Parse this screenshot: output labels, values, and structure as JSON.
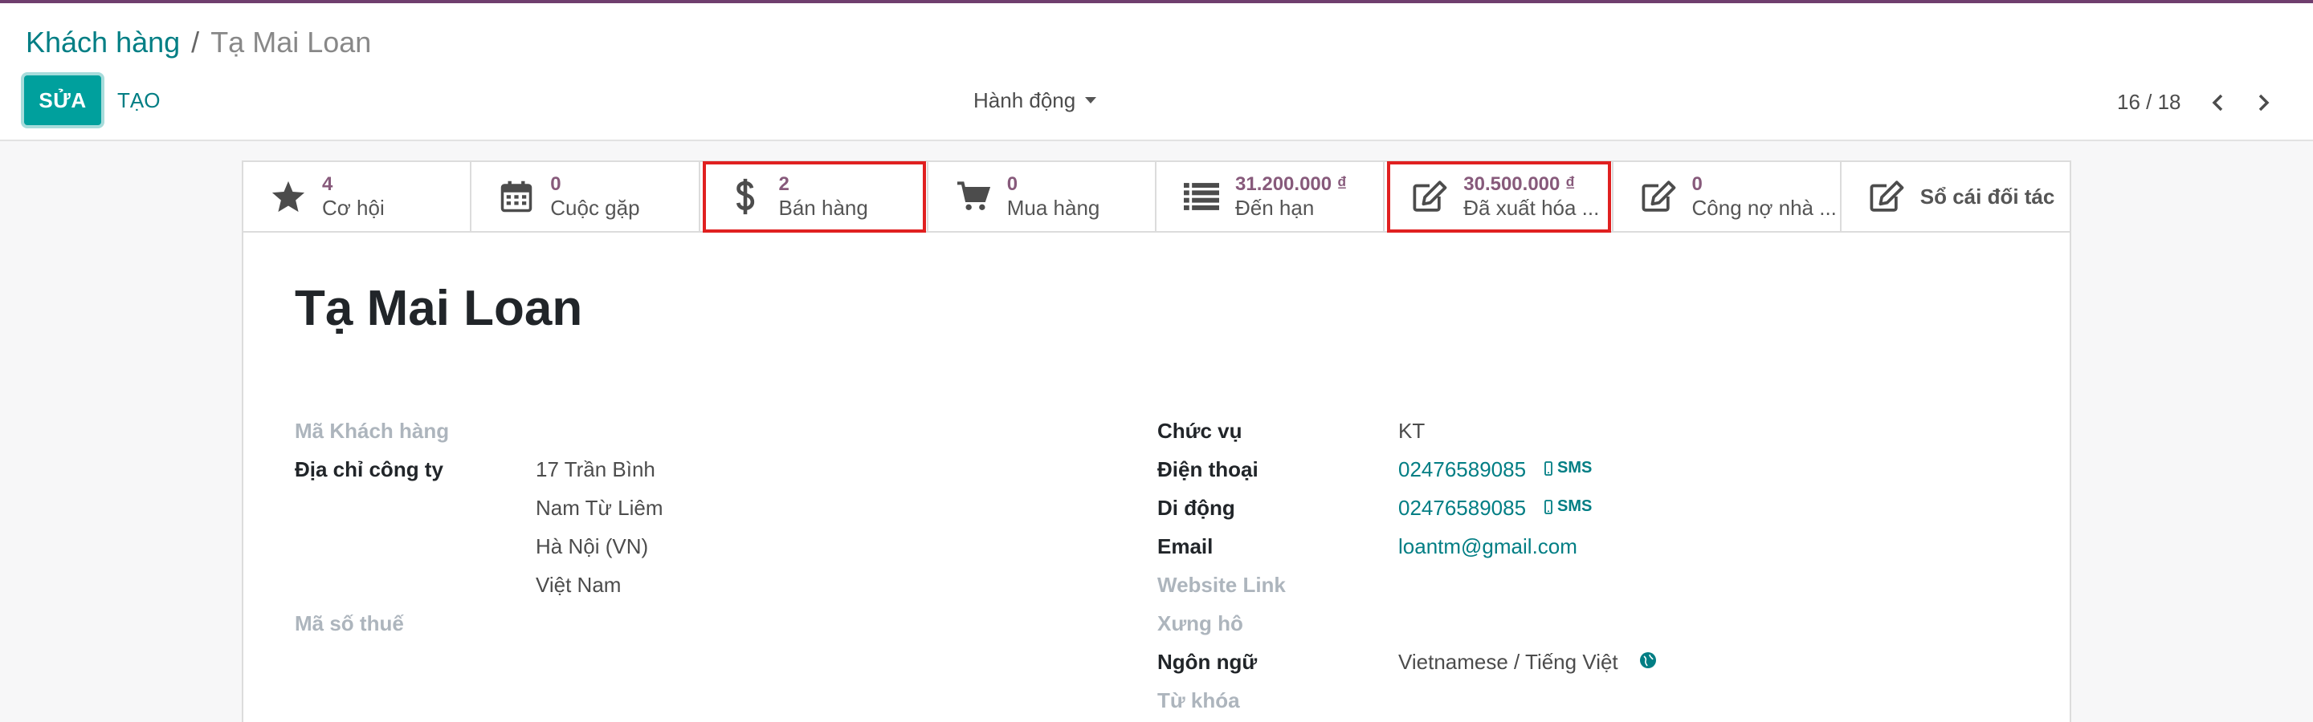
{
  "breadcrumb": {
    "parent": "Khách hàng",
    "separator": "/",
    "current": "Tạ Mai Loan"
  },
  "toolbar": {
    "edit_label": "SỬA",
    "create_label": "TẠO",
    "action_label": "Hành động"
  },
  "pager": {
    "value": "16 / 18"
  },
  "smart_buttons": [
    {
      "value": "4",
      "label": "Cơ hội",
      "icon": "star-icon"
    },
    {
      "value": "0",
      "label": "Cuộc gặp",
      "icon": "calendar-icon"
    },
    {
      "value": "2",
      "label": "Bán hàng",
      "icon": "dollar-icon"
    },
    {
      "value": "0",
      "label": "Mua hàng",
      "icon": "cart-icon"
    },
    {
      "value": "31.200.000 ₫",
      "label": "Đến hạn",
      "icon": "list-icon"
    },
    {
      "value": "30.500.000 ₫",
      "label": "Đã xuất hóa ...",
      "icon": "edit-icon"
    },
    {
      "value": "0",
      "label": "Công nợ nhà ...",
      "icon": "edit-icon"
    },
    {
      "label": "Sổ cái đối tác",
      "icon": "edit-icon"
    }
  ],
  "record": {
    "name": "Tạ Mai Loan"
  },
  "left_fields": {
    "customer_code_label": "Mã Khách hàng",
    "address_label": "Địa chỉ công ty",
    "address_lines": [
      "17 Trần Bình",
      "Nam Từ Liêm",
      "Hà Nội (VN)",
      "Việt Nam"
    ],
    "tax_label": "Mã số thuế"
  },
  "right_fields": {
    "position_label": "Chức vụ",
    "position_value": "KT",
    "phone_label": "Điện thoại",
    "phone_value": "02476589085",
    "mobile_label": "Di động",
    "mobile_value": "02476589085",
    "email_label": "Email",
    "email_value": "loantm@gmail.com",
    "website_label": "Website Link",
    "title_label": "Xưng hô",
    "language_label": "Ngôn ngữ",
    "language_value": "Vietnamese / Tiếng Việt",
    "tags_label": "Từ khóa",
    "sms_label": "SMS"
  },
  "colors": {
    "primary": "#00a09d",
    "link": "#017e84",
    "stat_value": "#875a7b",
    "highlight": "#e02020",
    "topbar": "#6f3e6e"
  }
}
